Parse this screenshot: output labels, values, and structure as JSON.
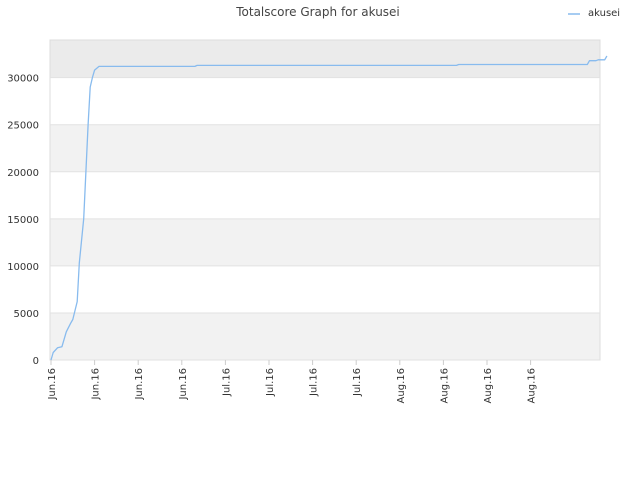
{
  "chart_data": {
    "type": "line",
    "title": "Totalscore Graph for akusei",
    "xlabel": "",
    "ylabel": "",
    "ylim": [
      0,
      34000
    ],
    "y_ticks": [
      0,
      5000,
      10000,
      15000,
      20000,
      25000,
      30000
    ],
    "x_tick_labels": [
      "Jun.16",
      "Jun.16",
      "Jun.16",
      "Jun.16",
      "Jul.16",
      "Jul.16",
      "Jul.16",
      "Jul.16",
      "Aug.16",
      "Aug.16",
      "Aug.16",
      "Aug.16"
    ],
    "grid": "horizontal bands",
    "legend": {
      "position": "top-right",
      "entries": [
        "akusei"
      ]
    },
    "colors": {
      "line": "#88bbee",
      "band_light": "#f2f2f2",
      "band_white": "#ffffff",
      "top_band": "#ebebeb"
    },
    "series": [
      {
        "name": "akusei",
        "x": [
          0,
          0.05,
          0.15,
          0.25,
          0.35,
          0.45,
          0.5,
          0.6,
          0.65,
          0.75,
          0.8,
          0.85,
          0.9,
          0.95,
          1.0,
          1.05,
          1.1,
          1.15,
          1.25,
          1.3,
          1.4,
          1.5,
          1.6,
          3.3,
          3.35,
          9.3,
          9.35,
          12.3,
          12.35,
          12.5,
          12.55,
          12.7,
          12.75
        ],
        "y": [
          0,
          800,
          1300,
          1400,
          3000,
          3900,
          4300,
          6200,
          10300,
          15000,
          20000,
          25000,
          29000,
          30000,
          30800,
          31000,
          31200,
          31200,
          31200,
          31200,
          31200,
          31200,
          31200,
          31200,
          31300,
          31300,
          31400,
          31400,
          31800,
          31800,
          31900,
          31900,
          32300
        ]
      }
    ]
  }
}
